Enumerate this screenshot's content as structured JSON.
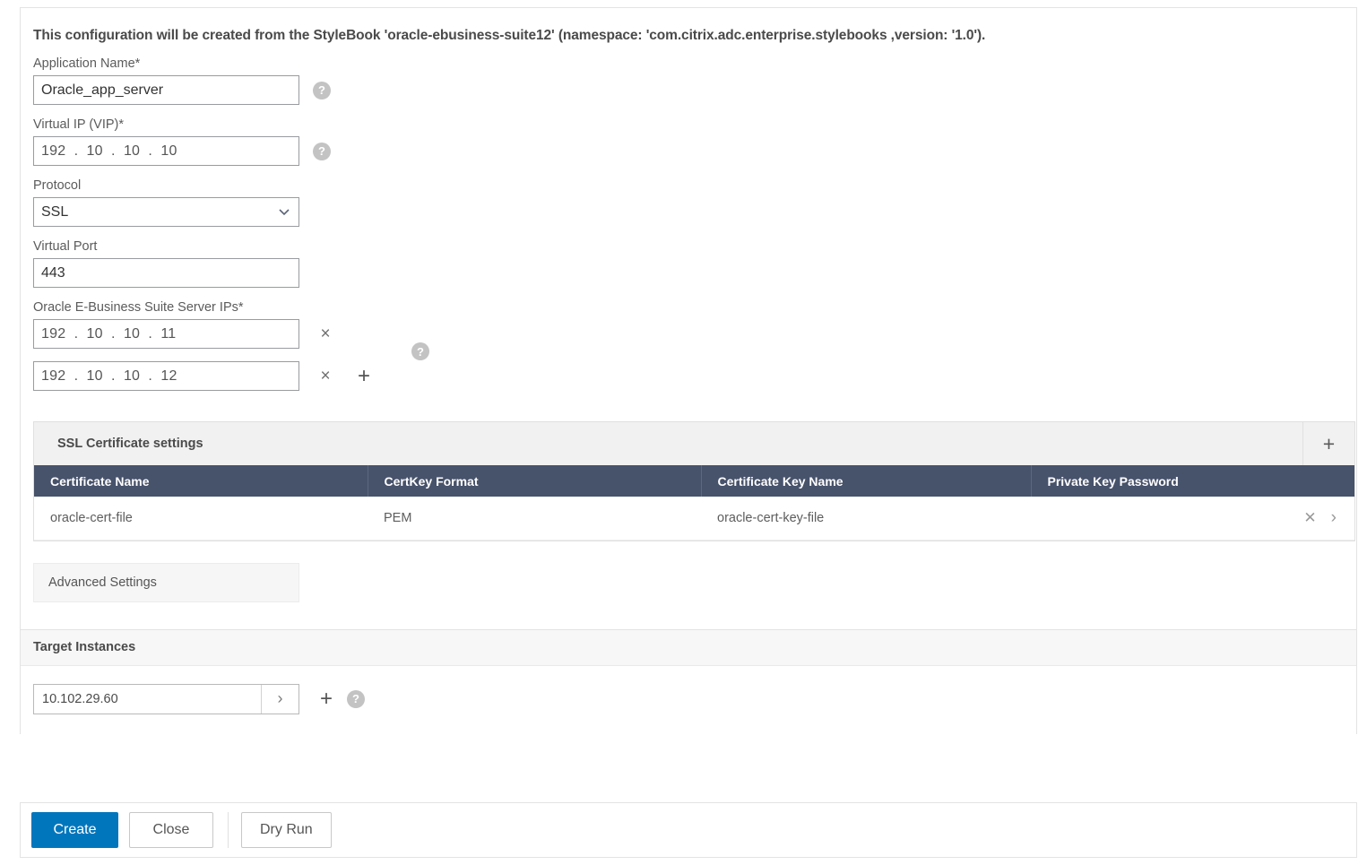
{
  "intro": {
    "text": "This configuration will be created from the StyleBook 'oracle-ebusiness-suite12' (namespace: 'com.citrix.adc.enterprise.stylebooks ,version: '1.0')."
  },
  "form": {
    "application_name": {
      "label": "Application Name*",
      "value": "Oracle_app_server",
      "help": "?"
    },
    "virtual_ip": {
      "label": "Virtual IP (VIP)*",
      "value": "192  .  10  .  10  .  10",
      "help": "?"
    },
    "protocol": {
      "label": "Protocol",
      "value": "SSL",
      "options": [
        "SSL"
      ]
    },
    "virtual_port": {
      "label": "Virtual Port",
      "value": "443"
    },
    "server_ips": {
      "label": "Oracle E-Business Suite Server IPs*",
      "help": "?",
      "remove_label": "×",
      "add_label": "+",
      "rows": [
        {
          "value": "192  .  10  .  10  .  11"
        },
        {
          "value": "192  .  10  .  10  .  12"
        }
      ]
    }
  },
  "ssl_panel": {
    "title": "SSL Certificate settings",
    "add_label": "+",
    "columns": [
      "Certificate Name",
      "CertKey Format",
      "Certificate Key Name",
      "Private Key Password"
    ],
    "rows": [
      {
        "certificate_name": "oracle-cert-file",
        "certkey_format": "PEM",
        "certificate_key_name": "oracle-cert-key-file",
        "private_key_password": "",
        "remove_label": "✕",
        "expand_label": "›"
      }
    ]
  },
  "advanced_settings": {
    "label": "Advanced Settings"
  },
  "target_instances": {
    "title": "Target Instances",
    "value": "10.102.29.60",
    "go_label": "›",
    "add_label": "+",
    "help": "?"
  },
  "footer": {
    "create_label": "Create",
    "close_label": "Close",
    "dry_run_label": "Dry Run"
  },
  "colors": {
    "primary": "#0076bd",
    "table_header": "#47526b",
    "panel_header": "#f1f1f1"
  }
}
